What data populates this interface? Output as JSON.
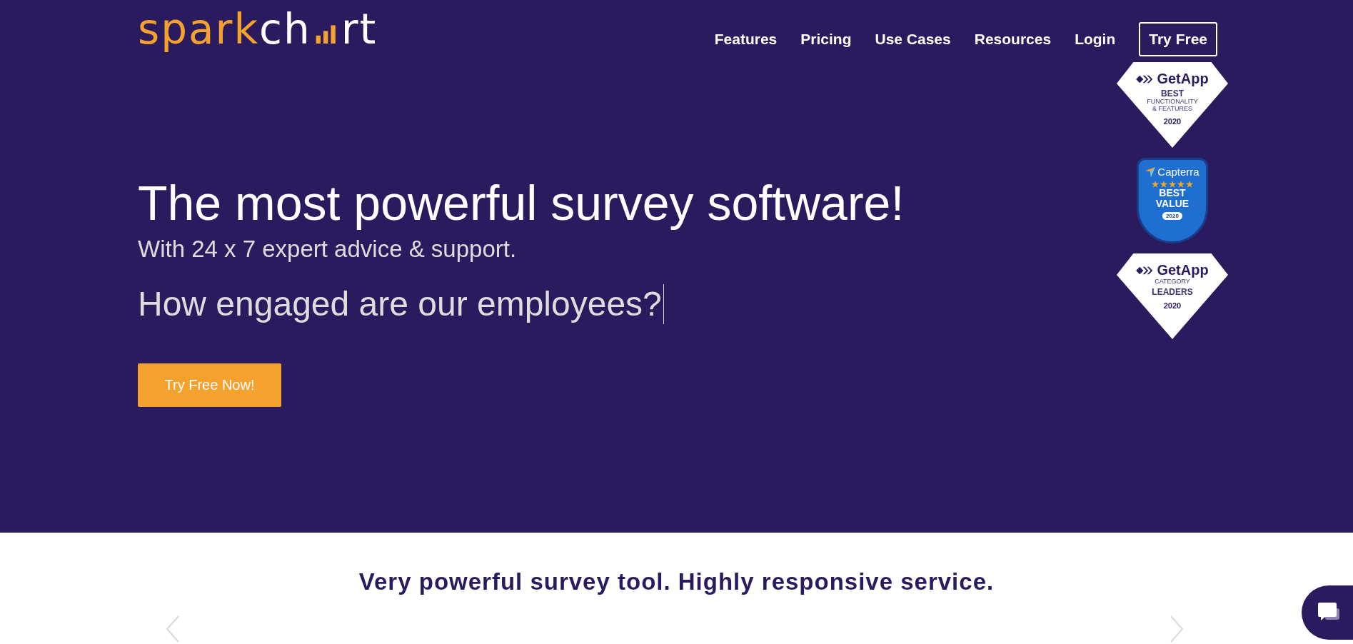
{
  "header": {
    "logo": {
      "prefix": "spark",
      "middle": "ch",
      "suffix": "rt"
    },
    "nav": [
      {
        "label": "Features",
        "kind": "link"
      },
      {
        "label": "Pricing",
        "kind": "link"
      },
      {
        "label": "Use Cases",
        "kind": "link"
      },
      {
        "label": "Resources",
        "kind": "link"
      },
      {
        "label": "Login",
        "kind": "link"
      },
      {
        "label": "Try Free",
        "kind": "button"
      }
    ]
  },
  "hero": {
    "title": "The most powerful survey software!",
    "subtitle": "With 24 x 7 expert advice & support.",
    "question": "How engaged are our employees?",
    "button": "Try Free Now!",
    "badges": [
      {
        "kind": "getapp",
        "brand": "GetApp",
        "lines": [
          "BEST",
          "FUNCTIONALITY",
          "& FEATURES"
        ],
        "year": "2020"
      },
      {
        "kind": "capterra",
        "brand": "Capterra",
        "stars": 5,
        "lines": [
          "BEST",
          "VALUE"
        ],
        "year": "2020"
      },
      {
        "kind": "getapp",
        "brand": "GetApp",
        "lines": [
          "CATEGORY",
          "LEADERS"
        ],
        "year": "2020"
      }
    ]
  },
  "testimonial": {
    "quote": "Very powerful survey tool. Highly responsive service."
  }
}
